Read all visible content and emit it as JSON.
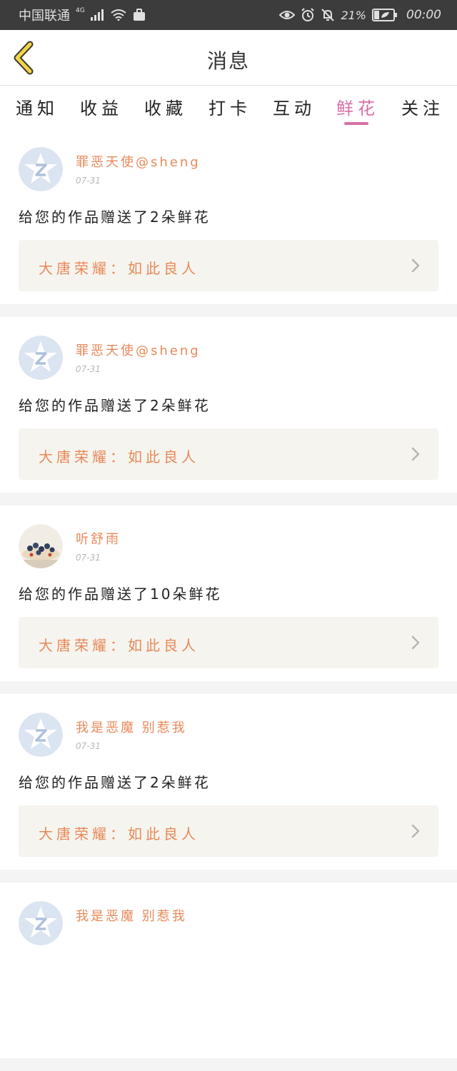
{
  "status_bar": {
    "carrier": "中国联通",
    "network": "4G",
    "battery_percent": "21%",
    "time": "00:00"
  },
  "header": {
    "title": "消息",
    "back_icon": "chevron-left-icon"
  },
  "tabs": [
    {
      "label": "通知",
      "active": false
    },
    {
      "label": "收益",
      "active": false
    },
    {
      "label": "收藏",
      "active": false
    },
    {
      "label": "打卡",
      "active": false
    },
    {
      "label": "互动",
      "active": false
    },
    {
      "label": "鲜花",
      "active": true
    },
    {
      "label": "关注",
      "active": false
    }
  ],
  "messages": [
    {
      "sender": "罪恶天使@sheng",
      "date": "07-31",
      "text": "给您的作品赠送了2朵鲜花",
      "work": "大唐荣耀：如此良人",
      "avatar": "qq-default-avatar"
    },
    {
      "sender": "罪恶天使@sheng",
      "date": "07-31",
      "text": "给您的作品赠送了2朵鲜花",
      "work": "大唐荣耀：如此良人",
      "avatar": "qq-default-avatar"
    },
    {
      "sender": "听舒雨",
      "date": "07-31",
      "text": "给您的作品赠送了10朵鲜花",
      "work": "大唐荣耀：如此良人",
      "avatar": "photo-avatar"
    },
    {
      "sender": "我是恶魔 别惹我",
      "date": "07-31",
      "text": "给您的作品赠送了2朵鲜花",
      "work": "大唐荣耀：如此良人",
      "avatar": "qq-default-avatar"
    },
    {
      "sender": "我是恶魔 别惹我",
      "date": "",
      "text": "",
      "work": "",
      "avatar": "qq-default-avatar"
    }
  ],
  "colors": {
    "accent": "#d96fa5",
    "name_color": "#e8895a",
    "status_bar_bg": "#3c3c3c",
    "work_bg": "#f6f4ee"
  }
}
